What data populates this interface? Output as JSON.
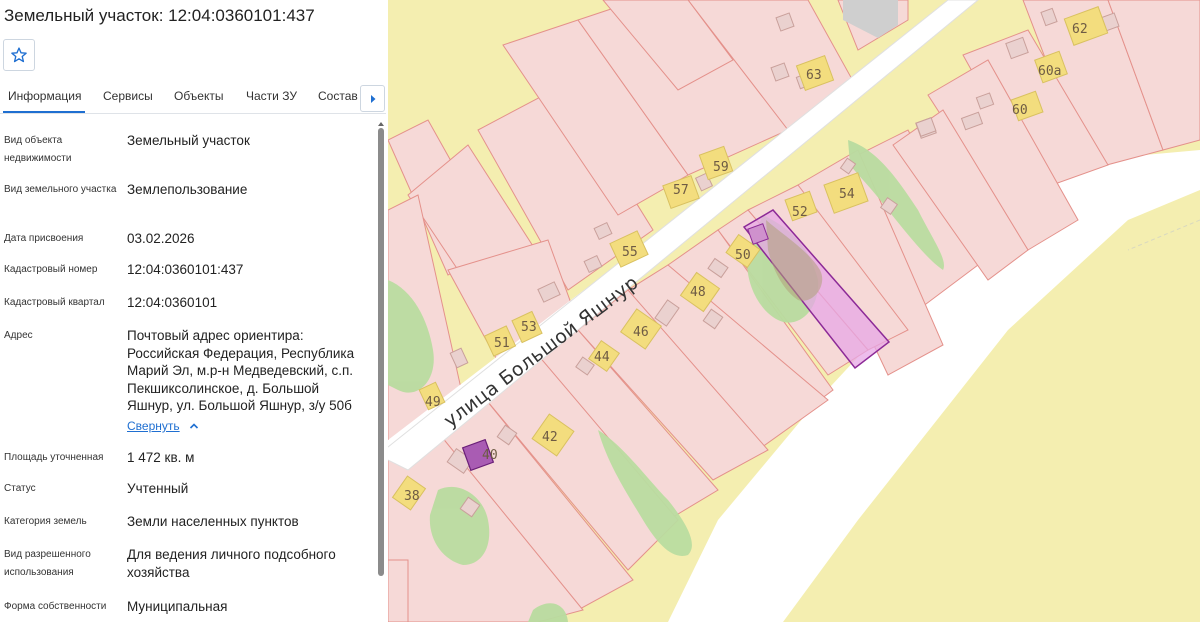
{
  "header": {
    "title": "Земельный участок: 12:04:0360101:437"
  },
  "toolbar": {
    "favorite_icon": "star-outline-icon"
  },
  "tabs": [
    {
      "label": "Информация",
      "active": true
    },
    {
      "label": "Сервисы"
    },
    {
      "label": "Объекты"
    },
    {
      "label": "Части ЗУ"
    },
    {
      "label": "Состав"
    }
  ],
  "info": {
    "rows": [
      {
        "label": "Вид объекта недвижимости",
        "value": "Земельный участок"
      },
      {
        "label": "Вид земельного участка",
        "value": "Землепользование"
      },
      {
        "label": "Дата присвоения",
        "value": "03.02.2026"
      },
      {
        "label": "Кадастровый номер",
        "value": "12:04:0360101:437"
      },
      {
        "label": "Кадастровый квартал",
        "value": "12:04:0360101"
      },
      {
        "label": "Адрес",
        "value": "Почтовый адрес ориентира: Российская Федерация, Республика Марий Эл, м.р-н Медведевский, с.п. Пекшиксолинское, д. Большой Яшнур, ул. Большой Яшнур, з/у 50б"
      },
      {
        "label": "Площадь уточненная",
        "value": "1 472 кв. м"
      },
      {
        "label": "Статус",
        "value": "Учтенный"
      },
      {
        "label": "Категория земель",
        "value": "Земли населенных пунктов"
      },
      {
        "label": "Вид разрешенного использования",
        "value": "Для ведения личного подсобного хозяйства"
      },
      {
        "label": "Форма собственности",
        "value": "Муниципальная"
      }
    ],
    "collapse_label": "Свернуть"
  },
  "map": {
    "street_label": "улица Большой Яшнур",
    "house_numbers": [
      "62",
      "63",
      "60а",
      "60",
      "59",
      "57",
      "54",
      "52",
      "55",
      "50",
      "53",
      "48",
      "46",
      "51",
      "44",
      "49",
      "42",
      "40",
      "38"
    ],
    "colors": {
      "parcel_fill": "#f6d9d7",
      "parcel_stroke": "#e4918b",
      "road": "#ffffff",
      "building": "#f3dd7e",
      "vegetation": "#b9dca0",
      "selected_parcel": "#e7a7e6",
      "selected_stroke": "#8c2a97"
    }
  }
}
